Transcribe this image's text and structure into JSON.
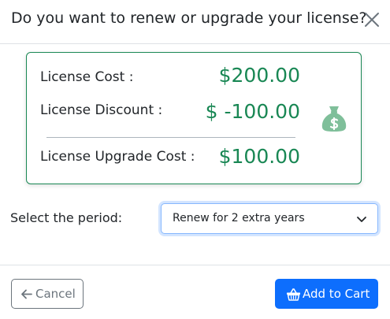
{
  "dialog": {
    "title": "Do you want to renew or upgrade your license?",
    "close_icon": "close-icon"
  },
  "costs": {
    "license_cost_label": "License Cost :",
    "license_cost_value": "$200.00",
    "license_discount_label": "License Discount :",
    "license_discount_value": "$ -100.00",
    "license_upgrade_cost_label": "License Upgrade Cost :",
    "license_upgrade_cost_value": "$100.00",
    "money_icon": "money-bag-icon"
  },
  "period": {
    "label": "Select the period:",
    "selected": "Renew for 2 extra years"
  },
  "footer": {
    "cancel_label": "Cancel",
    "add_to_cart_label": "Add to Cart"
  },
  "colors": {
    "accent_green": "#198754",
    "primary_blue": "#0d6efd",
    "secondary_gray": "#6c757d"
  }
}
